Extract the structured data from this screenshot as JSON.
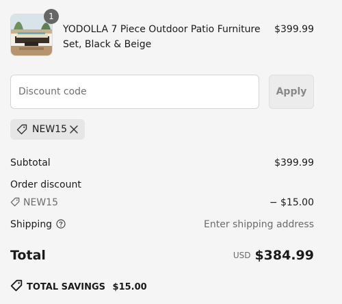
{
  "product": {
    "quantity": "1",
    "title": "YODOLLA 7 Piece Outdoor Patio Furniture Set, Black & Beige",
    "price": "$399.99",
    "image_icon": "patio-furniture-photo"
  },
  "discount": {
    "placeholder": "Discount code",
    "value": "",
    "apply_label": "Apply",
    "applied_code": "NEW15",
    "tag_icon": "tag-icon",
    "remove_icon": "close-icon"
  },
  "summary": {
    "subtotal_label": "Subtotal",
    "subtotal_value": "$399.99",
    "order_discount_label": "Order discount",
    "order_discount_code": "NEW15",
    "order_discount_value": "− $15.00",
    "shipping_label": "Shipping",
    "shipping_help_icon": "help-circle-icon",
    "shipping_value": "Enter shipping address",
    "total_label": "Total",
    "total_currency": "USD",
    "total_value": "$384.99",
    "savings_label": "TOTAL SAVINGS",
    "savings_value": "$15.00"
  },
  "colors": {
    "background": "#f5f5f5",
    "text": "#1a1a1a",
    "muted": "#6b6b6b",
    "badge": "#666666",
    "chip": "#e6e6e6"
  }
}
